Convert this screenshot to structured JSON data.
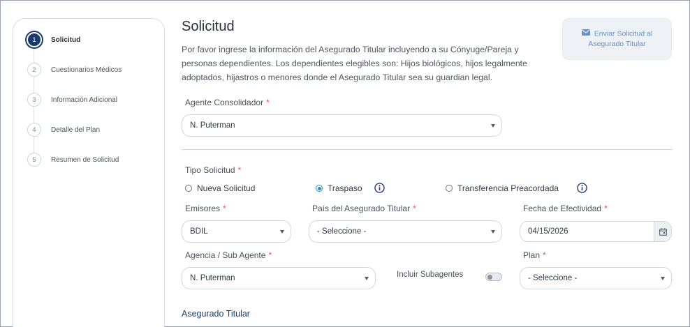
{
  "stepper": {
    "steps": [
      {
        "num": "1",
        "label": "Solicitud",
        "active": true
      },
      {
        "num": "2",
        "label": "Cuestionarios Médicos"
      },
      {
        "num": "3",
        "label": "Información Adicional"
      },
      {
        "num": "4",
        "label": "Detalle del Plan"
      },
      {
        "num": "5",
        "label": "Resumen de Solicitud"
      }
    ]
  },
  "header": {
    "title": "Solicitud",
    "description": "Por favor ingrese la información del Asegurado Titular incluyendo a su Cónyuge/Pareja y personas dependientes. Los dependientes elegibles son: Hijos biológicos, hijos legalmente adoptados, hijastros o menores donde el Asegurado Titular sea su guardian legal.",
    "send_button_line1": "Enviar Solicitud al",
    "send_button_line2": "Asegurado Titular"
  },
  "form": {
    "agente_label": "Agente Consolidador",
    "agente_value": "N. Puterman",
    "tipo_label": "Tipo Solicitud",
    "tipo_options": [
      "Nueva Solicitud",
      "Traspaso",
      "Transferencia Preacordada"
    ],
    "tipo_selected": "Traspaso",
    "emisores_label": "Emisores",
    "emisores_value": "BDIL",
    "pais_label": "País del Asegurado Titular",
    "pais_value": "- Seleccione -",
    "fecha_label": "Fecha de Efectividad",
    "fecha_value": "04/15/2026",
    "agencia_label": "Agencia / Sub Agente",
    "agencia_value": "N. Puterman",
    "subagentes_label": "Incluir Subagentes",
    "subagentes_on": false,
    "plan_label": "Plan",
    "plan_value": "- Seleccione -",
    "required_mark": "*",
    "section_title": "Asegurado Titular"
  },
  "colors": {
    "accent": "#1a3a6b",
    "radio_checked": "#2e8fb8",
    "required": "#e0525a",
    "link": "#1d3f73"
  }
}
